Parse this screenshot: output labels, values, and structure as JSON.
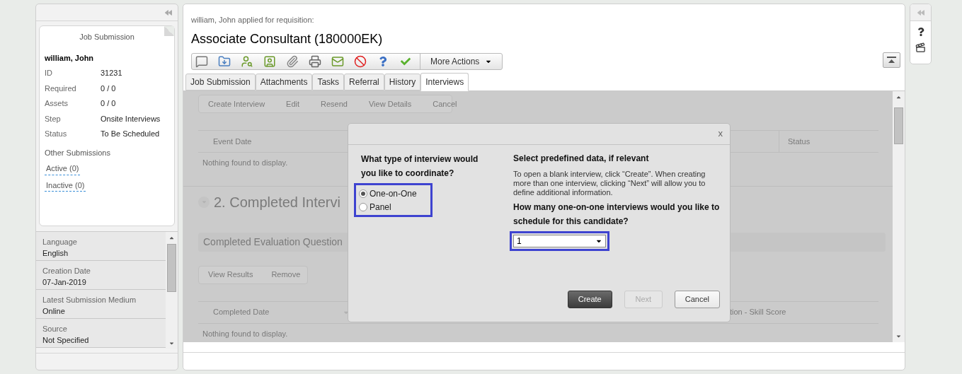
{
  "left_panel": {
    "card_title": "Job Submission",
    "candidate": "william, John",
    "fields": [
      {
        "label": "ID",
        "value": "31231"
      },
      {
        "label": "Required",
        "value": "0 / 0"
      },
      {
        "label": "Assets",
        "value": "0 / 0"
      },
      {
        "label": "Step",
        "value": "Onsite Interviews"
      },
      {
        "label": "Status",
        "value": "To Be Scheduled"
      }
    ],
    "other_submissions_title": "Other Submissions",
    "links": [
      "Active (0)",
      "Inactive (0)"
    ],
    "details": [
      {
        "label": "Language",
        "value": "English"
      },
      {
        "label": "Creation Date",
        "value": "07-Jan-2019"
      },
      {
        "label": "Latest Submission Medium",
        "value": "Online"
      },
      {
        "label": "Source",
        "value": "Not Specified"
      }
    ]
  },
  "header": {
    "subtitle": "william, John applied for requisition:",
    "title": "Associate Consultant (180000EK)"
  },
  "toolbar": {
    "more_actions": "More Actions"
  },
  "tabs": [
    {
      "label": "Job Submission",
      "selected": false
    },
    {
      "label": "Attachments",
      "selected": false
    },
    {
      "label": "Tasks",
      "selected": false
    },
    {
      "label": "Referral",
      "selected": false
    },
    {
      "label": "History",
      "selected": false
    },
    {
      "label": "Interviews",
      "selected": true
    }
  ],
  "background": {
    "actions": [
      "Create Interview",
      "Edit",
      "Resend",
      "View Details",
      "Cancel"
    ],
    "table1": {
      "columns": [
        "Event Date",
        "Status"
      ],
      "empty": "Nothing found to display."
    },
    "section_title": "2. Completed Intervi",
    "questionnaire_bar": "Completed Evaluation Question",
    "actions2": [
      "View Results",
      "Remove"
    ],
    "table2": {
      "columns": [
        "Completed Date",
        "tion - Skill Score"
      ],
      "empty": "Nothing found to display."
    }
  },
  "dialog": {
    "close": "x",
    "question": "What type of interview would you like to coordinate?",
    "options": [
      {
        "label": "One-on-One",
        "selected": true
      },
      {
        "label": "Panel",
        "selected": false
      }
    ],
    "right_title": "Select predefined data, if relevant",
    "help": "To open a blank interview, click “Create”. When creating more than one interview, clicking “Next” will allow you to define additional information.",
    "count_question": "How many one-on-one interviews would you like to schedule for this candidate?",
    "count": {
      "value": "1"
    },
    "buttons": [
      {
        "label": "Create",
        "kind": "primary"
      },
      {
        "label": "Next",
        "kind": "disabled"
      },
      {
        "label": "Cancel",
        "kind": "default"
      }
    ]
  }
}
